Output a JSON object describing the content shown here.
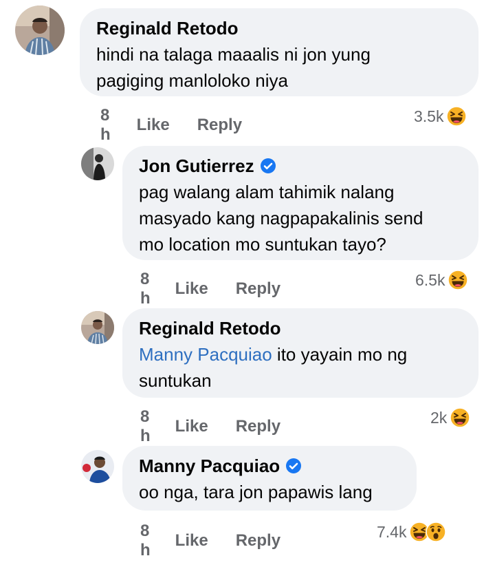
{
  "comments": [
    {
      "author": "Reginald Retodo",
      "verified": false,
      "text_lines": [
        "hindi na talaga maaalis ni jon yung",
        "pagiging manloloko niya"
      ],
      "time": "8 h",
      "like_label": "Like",
      "reply_label": "Reply",
      "reaction_count": "3.5k",
      "reactions": [
        "haha-icon"
      ]
    },
    {
      "author": "Jon Gutierrez",
      "verified": true,
      "text_lines": [
        "pag walang alam tahimik nalang",
        "masyado kang nagpapakalinis send",
        "mo location mo suntukan tayo?"
      ],
      "time": "8 h",
      "like_label": "Like",
      "reply_label": "Reply",
      "reaction_count": "6.5k",
      "reactions": [
        "haha-icon"
      ]
    },
    {
      "author": "Reginald Retodo",
      "verified": false,
      "mention": "Manny Pacquiao",
      "text_after_mention": " ito yayain mo ng",
      "text_line2": "suntukan",
      "time": "8 h",
      "like_label": "Like",
      "reply_label": "Reply",
      "reaction_count": "2k",
      "reactions": [
        "haha-icon"
      ]
    },
    {
      "author": "Manny Pacquiao",
      "verified": true,
      "text_lines": [
        "oo nga, tara jon papawis lang"
      ],
      "time": "8 h",
      "like_label": "Like",
      "reply_label": "Reply",
      "reaction_count": "7.4k",
      "reactions": [
        "haha-icon",
        "wow-icon"
      ]
    }
  ],
  "colors": {
    "bubble": "#f0f2f5",
    "meta_text": "#65676b",
    "mention": "#2e6fc0",
    "verified": "#1877f2",
    "reaction_yellow": "#f7b125"
  }
}
